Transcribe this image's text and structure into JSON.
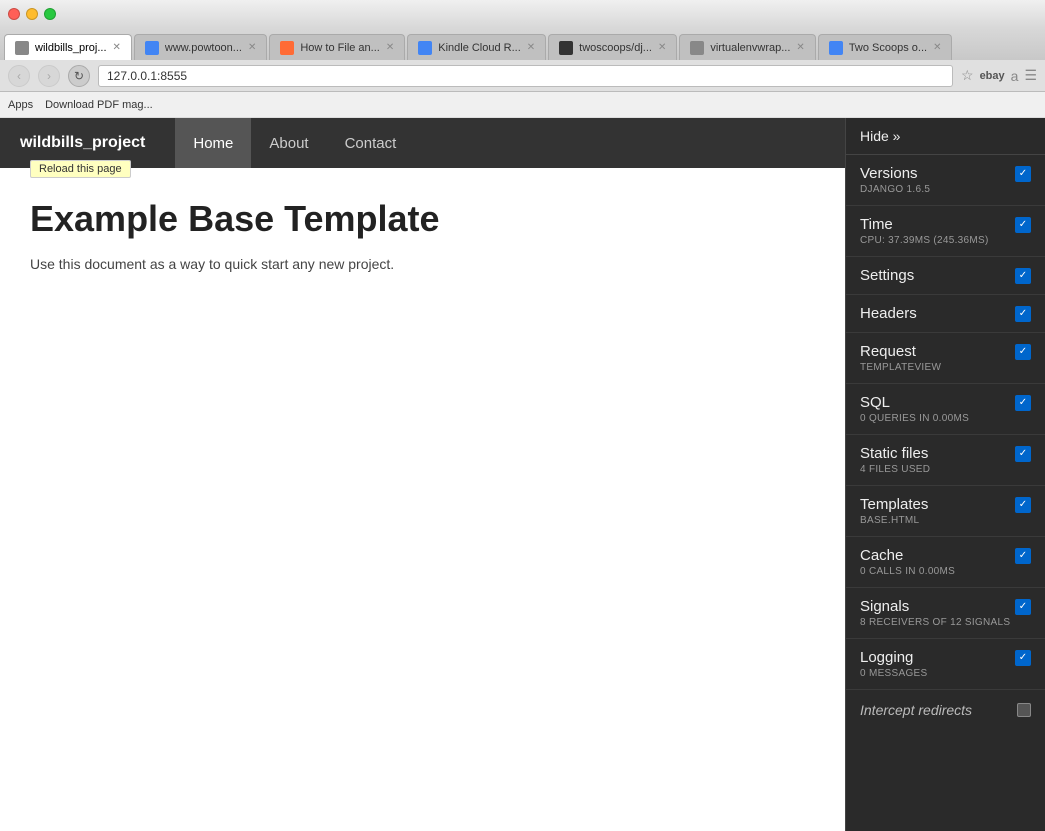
{
  "browser": {
    "traffic_lights": [
      "red",
      "yellow",
      "green"
    ],
    "tabs": [
      {
        "id": "tab1",
        "label": "wildbills_proj...",
        "favicon_class": "gray",
        "active": true
      },
      {
        "id": "tab2",
        "label": "www.powtoon...",
        "favicon_class": "blue",
        "active": false
      },
      {
        "id": "tab3",
        "label": "How to File an...",
        "favicon_class": "orange",
        "active": false
      },
      {
        "id": "tab4",
        "label": "Kindle Cloud R...",
        "favicon_class": "blue",
        "active": false
      },
      {
        "id": "tab5",
        "label": "twoscoops/dj...",
        "favicon_class": "dark",
        "active": false
      },
      {
        "id": "tab6",
        "label": "virtualenvwrap...",
        "favicon_class": "gray",
        "active": false
      },
      {
        "id": "tab7",
        "label": "Two Scoops o...",
        "favicon_class": "blue",
        "active": false
      }
    ],
    "address": "127.0.0.1:8555",
    "bookmarks": [
      {
        "label": "Apps"
      },
      {
        "label": "Download PDF mag..."
      }
    ]
  },
  "django": {
    "brand": "wildbills_project",
    "nav_links": [
      {
        "label": "Home",
        "active": true
      },
      {
        "label": "About",
        "active": false
      },
      {
        "label": "Contact",
        "active": false
      }
    ],
    "tooltip": "Reload this page",
    "heading": "Example Base Template",
    "subtext": "Use this document as a way to quick start any new project.",
    "subtext_link": "."
  },
  "toolbar": {
    "hide_label": "Hide »",
    "items": [
      {
        "name": "Versions",
        "sub": "Django 1.6.5",
        "checked": true
      },
      {
        "name": "Time",
        "sub": "CPU: 37.39ms (245.36ms)",
        "checked": true
      },
      {
        "name": "Settings",
        "sub": "",
        "checked": true
      },
      {
        "name": "Headers",
        "sub": "",
        "checked": true
      },
      {
        "name": "Request",
        "sub": "TemplateView",
        "checked": true
      },
      {
        "name": "SQL",
        "sub": "0 queries in 0.00ms",
        "checked": true
      },
      {
        "name": "Static files",
        "sub": "4 files used",
        "checked": true
      },
      {
        "name": "Templates",
        "sub": "base.html",
        "checked": true
      },
      {
        "name": "Cache",
        "sub": "0 calls in 0.00ms",
        "checked": true
      },
      {
        "name": "Signals",
        "sub": "8 receivers of 12 signals",
        "checked": true
      },
      {
        "name": "Logging",
        "sub": "0 messages",
        "checked": true
      }
    ],
    "intercept_label": "Intercept redirects",
    "intercept_checked": false
  }
}
